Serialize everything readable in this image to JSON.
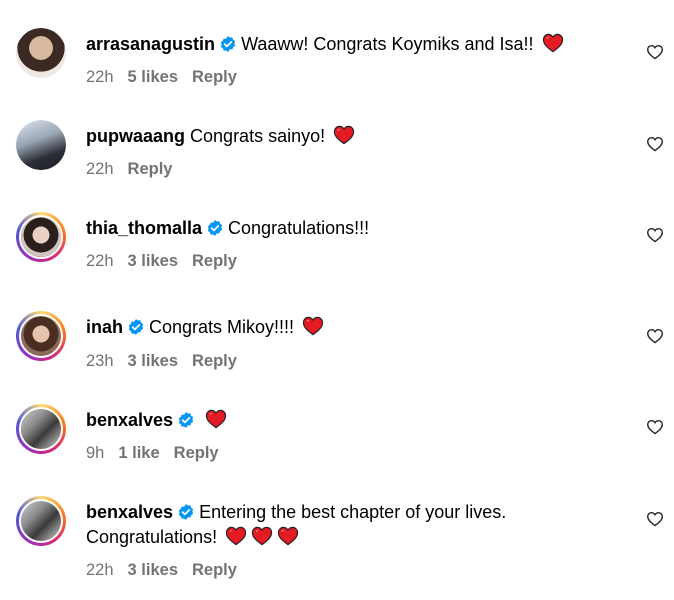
{
  "comments": [
    {
      "username": "arrasanagustin",
      "text": "Waaww! Congrats Koymiks and Isa!!",
      "time": "22h",
      "likes": "5 likes",
      "reply": "Reply"
    },
    {
      "username": "pupwaaang",
      "text": "Congrats sainyo!",
      "time": "22h",
      "likes": "",
      "reply": "Reply"
    },
    {
      "username": "thia_thomalla",
      "text": "Congratulations!!!",
      "time": "22h",
      "likes": "3 likes",
      "reply": "Reply"
    },
    {
      "username": "inah",
      "text": "Congrats Mikoy!!!!",
      "time": "23h",
      "likes": "3 likes",
      "reply": "Reply"
    },
    {
      "username": "benxalves",
      "text": "",
      "time": "9h",
      "likes": "1 like",
      "reply": "Reply"
    },
    {
      "username": "benxalves",
      "text": "Entering the best chapter of your lives.",
      "text2": "Congratulations!",
      "time": "22h",
      "likes": "3 likes",
      "reply": "Reply"
    }
  ],
  "icons": {
    "verified": "verified-badge-icon",
    "heart_emoji": "red-heart-emoji",
    "like": "heart-outline-icon"
  },
  "colors": {
    "verified": "#0095f6",
    "heart": "#e0245e",
    "meta": "#737373"
  }
}
